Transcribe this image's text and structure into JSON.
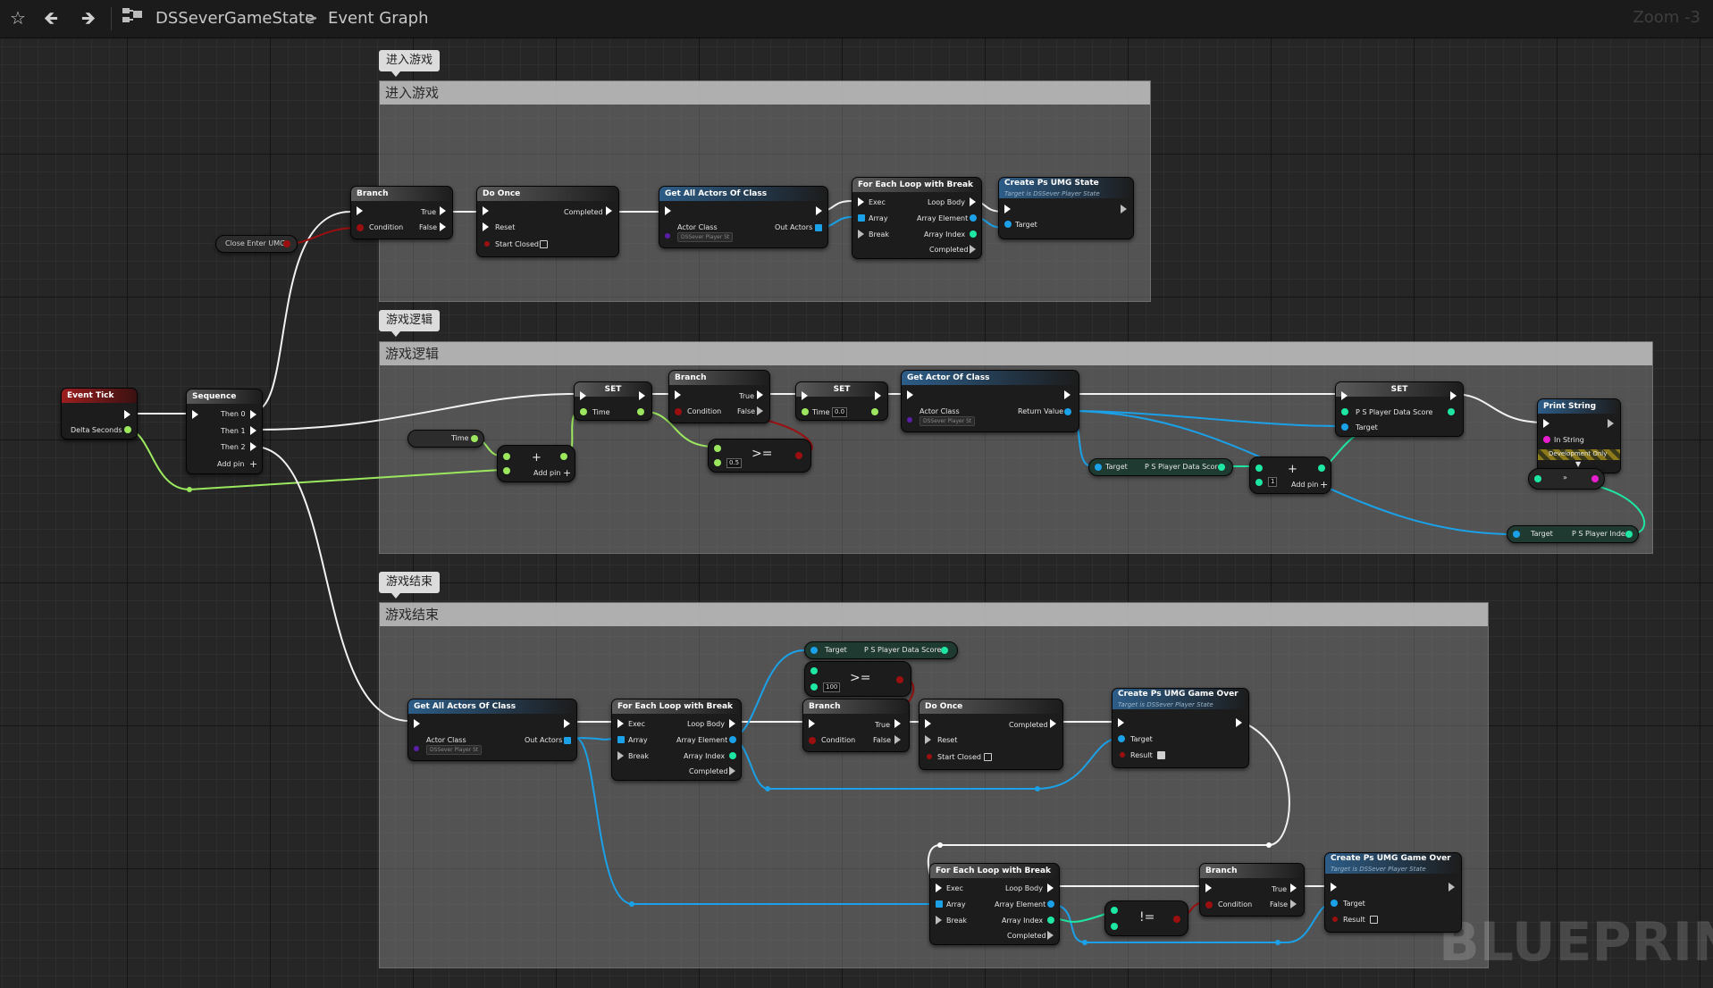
{
  "toolbar": {
    "star_icon": "star-icon",
    "back_icon": "arrow-left-icon",
    "forward_icon": "arrow-right-icon",
    "graph_icon": "blueprint-graph-icon",
    "crumb_root": "DSSeverGameState",
    "crumb_sep": ">",
    "crumb_current": "Event Graph",
    "zoom": "Zoom -3"
  },
  "watermark": "BLUEPRINT",
  "comments": [
    {
      "tab": "进入游戏",
      "title": "进入游戏"
    },
    {
      "tab": "游戏逻辑",
      "title": "游戏逻辑"
    },
    {
      "tab": "游戏结束",
      "title": "游戏结束"
    }
  ],
  "colors": {
    "exec": "#ffffff",
    "bool": "#9b0f0f",
    "float": "#9be85f",
    "object": "#1aa1e8",
    "int": "#1ee6a3",
    "string": "#e91ecf",
    "class": "#5a1ea8"
  },
  "nodes": {
    "close_enter_umg": {
      "label": "Close Enter UMG"
    },
    "branch_enter": {
      "title": "Branch",
      "condition": "Condition",
      "true": "True",
      "false": "False"
    },
    "do_once_enter": {
      "title": "Do Once",
      "completed": "Completed",
      "reset": "Reset",
      "start_closed": "Start Closed"
    },
    "get_all_actors_enter": {
      "title": "Get All Actors Of Class",
      "actor_class": "Actor Class",
      "out_actors": "Out Actors",
      "class_value": "DSSever Player St"
    },
    "for_each_enter": {
      "title": "For Each Loop with Break",
      "exec": "Exec",
      "loop_body": "Loop Body",
      "array": "Array",
      "array_element": "Array Element",
      "break": "Break",
      "array_index": "Array Index",
      "completed": "Completed"
    },
    "create_ps_umg_state": {
      "title": "Create Ps UMG State",
      "subtitle": "Target is DSSever Player State",
      "target": "Target"
    },
    "event_tick": {
      "title": "Event Tick",
      "delta": "Delta Seconds"
    },
    "sequence": {
      "title": "Sequence",
      "then0": "Then 0",
      "then1": "Then 1",
      "then2": "Then 2",
      "add_pin": "Add pin"
    },
    "time_getter": {
      "label": "Time"
    },
    "add_float": {
      "add_pin": "Add pin"
    },
    "set_time_1": {
      "title": "SET",
      "time": "Time"
    },
    "branch_logic": {
      "title": "Branch",
      "condition": "Condition",
      "true": "True",
      "false": "False"
    },
    "ge_float": {
      "op": ">=",
      "value": "0.5"
    },
    "set_time_2": {
      "title": "SET",
      "time": "Time",
      "value": "0.0"
    },
    "get_actor_of_class": {
      "title": "Get Actor Of Class",
      "actor_class": "Actor Class",
      "return_value": "Return Value",
      "class_value": "DSSever Player St"
    },
    "set_score": {
      "title": "SET",
      "score": "P S Player Data Score",
      "target": "Target"
    },
    "print_string": {
      "title": "Print String",
      "in_string": "In String",
      "dev_only": "Development Only"
    },
    "score_getter": {
      "target": "Target",
      "value": "P S Player Data Score"
    },
    "add_int": {
      "value": "1",
      "add_pin": "Add pin"
    },
    "to_string": {
      "label": "»"
    },
    "player_index_getter": {
      "target": "Target",
      "value": "P S Player Index"
    },
    "get_all_actors_end": {
      "title": "Get All Actors Of Class",
      "actor_class": "Actor Class",
      "out_actors": "Out Actors",
      "class_value": "DSSever Player St"
    },
    "for_each_end_1": {
      "title": "For Each Loop with Break",
      "exec": "Exec",
      "loop_body": "Loop Body",
      "array": "Array",
      "array_element": "Array Element",
      "break": "Break",
      "array_index": "Array Index",
      "completed": "Completed"
    },
    "score_getter_end": {
      "target": "Target",
      "value": "P S Player Data Score"
    },
    "ge_int": {
      "op": ">=",
      "value": "100"
    },
    "branch_end_1": {
      "title": "Branch",
      "condition": "Condition",
      "true": "True",
      "false": "False"
    },
    "do_once_end": {
      "title": "Do Once",
      "completed": "Completed",
      "reset": "Reset",
      "start_closed": "Start Closed"
    },
    "create_game_over_1": {
      "title": "Create Ps UMG Game Over",
      "subtitle": "Target is DSSever Player State",
      "target": "Target",
      "result": "Result"
    },
    "for_each_end_2": {
      "title": "For Each Loop with Break",
      "exec": "Exec",
      "loop_body": "Loop Body",
      "array": "Array",
      "array_element": "Array Element",
      "break": "Break",
      "array_index": "Array Index",
      "completed": "Completed"
    },
    "not_equal": {
      "op": "!="
    },
    "branch_end_2": {
      "title": "Branch",
      "condition": "Condition",
      "true": "True",
      "false": "False"
    },
    "create_game_over_2": {
      "title": "Create Ps UMG Game Over",
      "subtitle": "Target is DSSever Player State",
      "target": "Target",
      "result": "Result"
    }
  }
}
